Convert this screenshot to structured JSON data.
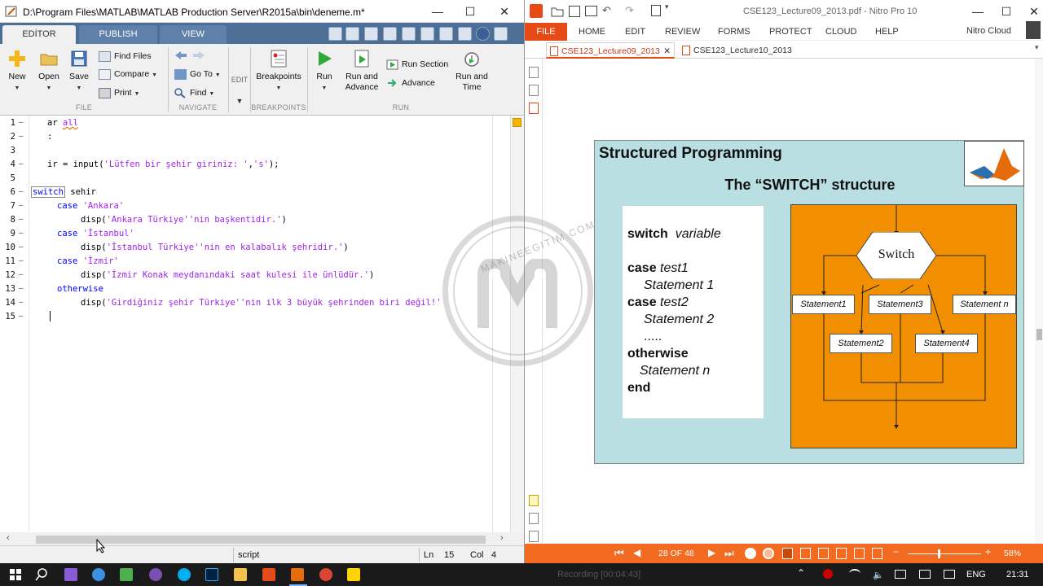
{
  "matlab": {
    "title": "D:\\Program Files\\MATLAB\\MATLAB Production Server\\R2015a\\bin\\deneme.m*",
    "tabs": [
      {
        "label": "EDİTOR"
      },
      {
        "label": "PUBLISH"
      },
      {
        "label": "VIEW"
      }
    ],
    "ribbon": {
      "file": {
        "new": "New",
        "open": "Open",
        "save": "Save",
        "find_files": "Find Files",
        "compare": "Compare",
        "print": "Print",
        "section": "FILE"
      },
      "navigate": {
        "go_to": "Go To",
        "find": "Find",
        "section": "NAVIGATE"
      },
      "edit": {
        "label": "EDIT"
      },
      "breakpoints": {
        "label": "Breakpoints",
        "section": "BREAKPOINTS"
      },
      "run": {
        "run": "Run",
        "run_and_advance_1": "Run and",
        "run_and_advance_2": "Advance",
        "run_section": "Run Section",
        "advance": "Advance",
        "run_and_time_1": "Run and",
        "run_and_time_2": "Time",
        "section": "RUN"
      }
    },
    "line_numbers": [
      "1",
      "2",
      "3",
      "4",
      "5",
      "6",
      "7",
      "8",
      "9",
      "10",
      "11",
      "12",
      "13",
      "14",
      "15"
    ],
    "code": {
      "l1a": "ar ",
      "l1b": "all",
      "l2": ":",
      "l4a": "ir = input(",
      "l4b": "'Lütfen bir şehir giriniz: '",
      "l4c": ",",
      "l4d": "'s'",
      "l4e": ");",
      "l6a": "switch",
      "l6b": " sehir",
      "l7a": "case ",
      "l7b": "'Ankara'",
      "l8a": "disp(",
      "l8b": "'Ankara Türkiye''nin başkentidir.'",
      "l8c": ")",
      "l9a": "case ",
      "l9b": "'İstanbul'",
      "l10a": "disp(",
      "l10b": "'İstanbul Türkiye''nin en kalabalık şehridir.'",
      "l10c": ")",
      "l11a": "case ",
      "l11b": "'İzmir'",
      "l12a": "disp(",
      "l12b": "'İzmir Konak meydanındaki saat kulesi ile ünlüdür.'",
      "l12c": ")",
      "l13": "otherwise",
      "l14a": "disp(",
      "l14b": "'Girdiğiniz şehir Türkiye''nin ilk 3 büyük şehrinden biri değil!'"
    },
    "status": {
      "type": "script",
      "ln_label": "Ln",
      "ln": "15",
      "col_label": "Col",
      "col": "4"
    }
  },
  "nitro": {
    "title": "CSE123_Lecture09_2013.pdf - Nitro Pro 10",
    "menu": [
      "FILE",
      "HOME",
      "EDIT",
      "REVIEW",
      "FORMS",
      "PROTECT",
      "CLOUD",
      "HELP"
    ],
    "cloud": "Nitro Cloud",
    "doc_tabs": [
      "CSE123_Lecture09_2013",
      "CSE123_Lecture10_2013"
    ],
    "page_indicator": "28 OF 48",
    "zoom": "58%"
  },
  "slide": {
    "title": "Structured Programming",
    "subtitle": "The “SWITCH” structure",
    "syntax": {
      "switch_kw": "switch",
      "variable": "variable",
      "case1_kw": "case",
      "test1": "test1",
      "stmt1": "Statement 1",
      "case2_kw": "case",
      "test2": "test2",
      "stmt2": "Statement 2",
      "dots": ".....",
      "otherwise_kw": "otherwise",
      "stmtn": "Statement n",
      "end_kw": "end"
    },
    "flow": {
      "switch": "Switch",
      "s1": "Statement1",
      "s3": "Statement3",
      "sn": "Statement n",
      "s2": "Statement2",
      "s4": "Statement4"
    }
  },
  "watermark": "MAKINEEGITIM.COM",
  "taskbar": {
    "recording": "Recording [00:04:43]",
    "lang": "ENG",
    "time": "21:31"
  },
  "colors": {
    "matlab_tabbar": "#4d6e95",
    "nitro_accent": "#e64b17",
    "slide_bg": "#b9dfe3",
    "flow_bg": "#f28f00"
  }
}
